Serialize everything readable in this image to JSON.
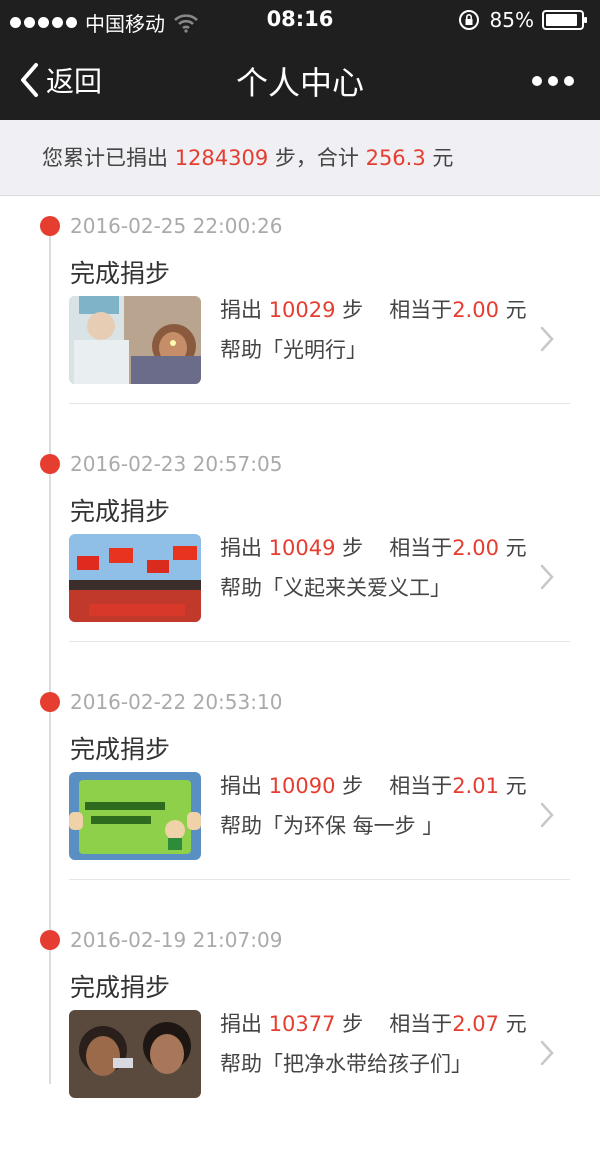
{
  "status_bar": {
    "carrier": "中国移动",
    "time": "08:16",
    "battery": "85%",
    "icons": [
      "signal-dots",
      "wifi-icon",
      "orientation-lock-icon",
      "battery-icon"
    ]
  },
  "nav": {
    "back_label": "返回",
    "title": "个人中心"
  },
  "summary": {
    "prefix": "您累计已捐出 ",
    "steps": "1284309",
    "mid": " 步，合计 ",
    "amount": "256.3",
    "suffix": " 元"
  },
  "labels": {
    "donated": "捐出 ",
    "step_unit": " 步",
    "equivalent": "相当于",
    "yuan": " 元"
  },
  "records": [
    {
      "timestamp": "2016-02-25 22:00:26",
      "title": "完成捐步",
      "steps": "10029",
      "amount": "2.00",
      "help_text": "帮助「光明行」",
      "image_desc": "eye-exam-photo"
    },
    {
      "timestamp": "2016-02-23 20:57:05",
      "title": "完成捐步",
      "steps": "10049",
      "amount": "2.00",
      "help_text": "帮助「义起来关爱义工」",
      "image_desc": "volunteers-with-flags-photo"
    },
    {
      "timestamp": "2016-02-22 20:53:10",
      "title": "完成捐步",
      "steps": "10090",
      "amount": "2.01",
      "help_text": "帮助「为环保 每一步 」",
      "image_desc": "environment-sign-photo"
    },
    {
      "timestamp": "2016-02-19 21:07:09",
      "title": "完成捐步",
      "steps": "10377",
      "amount": "2.07",
      "help_text": "帮助「把净水带给孩子们」",
      "image_desc": "children-drinking-photo"
    }
  ],
  "colors": {
    "header_bg": "#1f1f1f",
    "accent_red": "#e53d30",
    "summary_bg": "#efeff4",
    "muted_text": "#aaaaaa"
  }
}
